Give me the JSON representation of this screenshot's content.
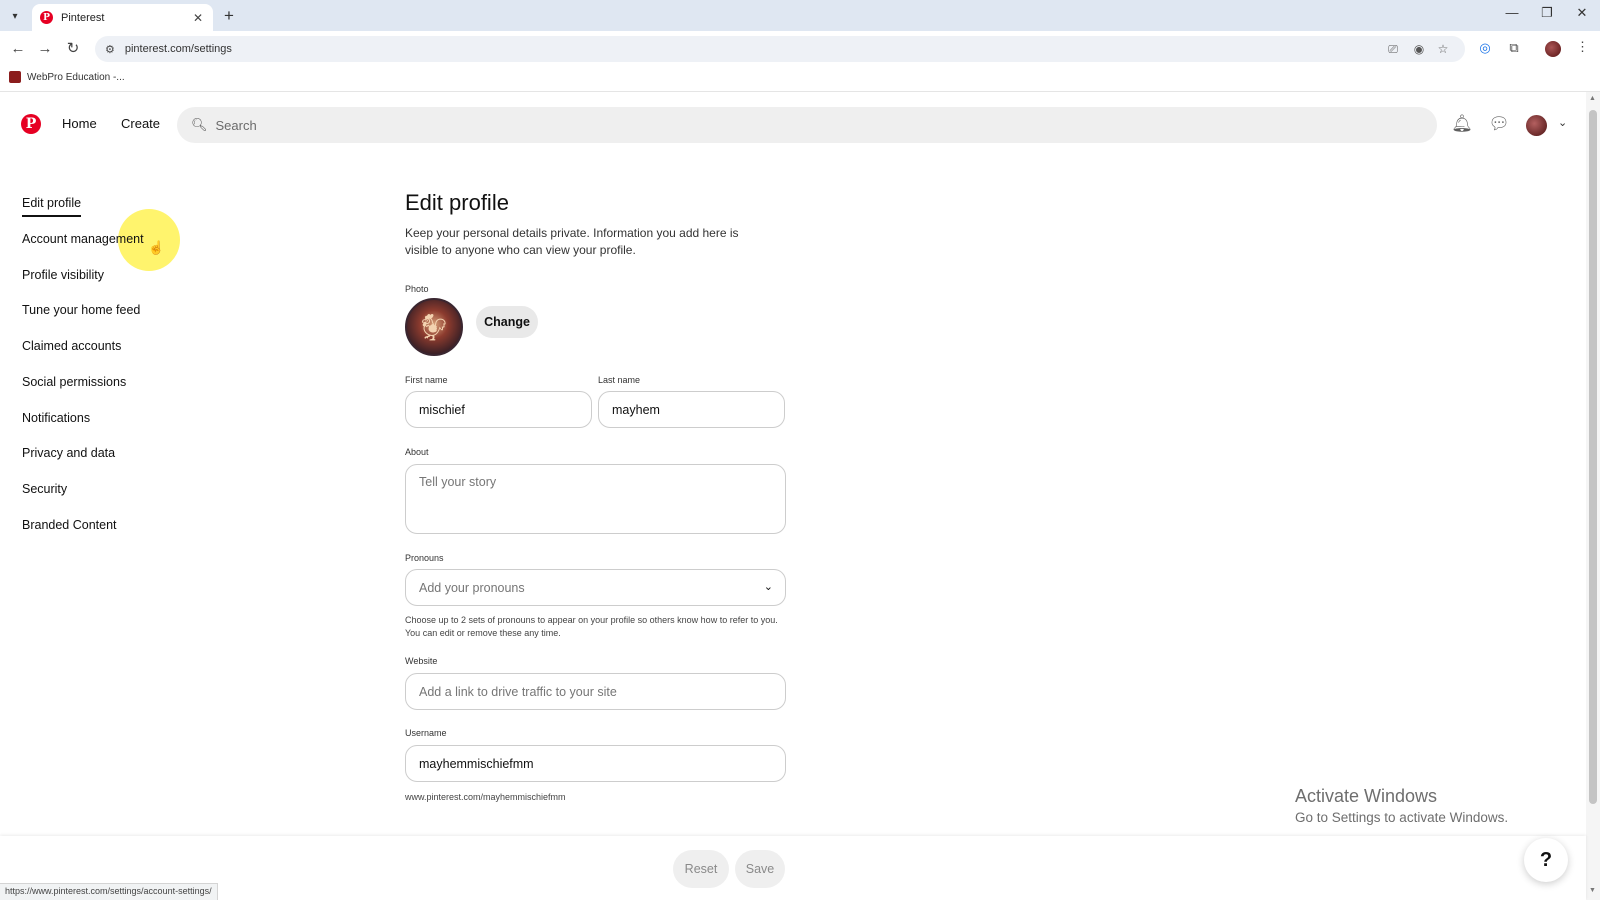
{
  "browser": {
    "tab_title": "Pinterest",
    "url": "pinterest.com/settings",
    "bookmark": "WebPro Education -..."
  },
  "header": {
    "logo": "P",
    "nav_home": "Home",
    "nav_create": "Create",
    "search_placeholder": "Search"
  },
  "sidebar": {
    "items": [
      {
        "label": "Edit profile",
        "active": true
      },
      {
        "label": "Account management"
      },
      {
        "label": "Profile visibility"
      },
      {
        "label": "Tune your home feed"
      },
      {
        "label": "Claimed accounts"
      },
      {
        "label": "Social permissions"
      },
      {
        "label": "Notifications"
      },
      {
        "label": "Privacy and data"
      },
      {
        "label": "Security"
      },
      {
        "label": "Branded Content"
      }
    ]
  },
  "main": {
    "title": "Edit profile",
    "description": "Keep your personal details private. Information you add here is visible to anyone who can view your profile.",
    "photo_label": "Photo",
    "change_button": "Change",
    "first_name_label": "First name",
    "first_name_value": "mischief",
    "last_name_label": "Last name",
    "last_name_value": "mayhem",
    "about_label": "About",
    "about_placeholder": "Tell your story",
    "pronouns_label": "Pronouns",
    "pronouns_placeholder": "Add your pronouns",
    "pronouns_help": "Choose up to 2 sets of pronouns to appear on your profile so others know how to refer to you. You can edit or remove these any time.",
    "website_label": "Website",
    "website_placeholder": "Add a link to drive traffic to your site",
    "username_label": "Username",
    "username_value": "mayhemmischiefmm",
    "profile_url": "www.pinterest.com/mayhemmischiefmm"
  },
  "footer": {
    "reset": "Reset",
    "save": "Save",
    "help": "?"
  },
  "overlay": {
    "activate_title": "Activate Windows",
    "activate_sub": "Go to Settings to activate Windows.",
    "status_url": "https://www.pinterest.com/settings/account-settings/"
  },
  "colors": {
    "brand": "#e60023",
    "tab_strip": "#dfe7f2",
    "cursor_highlight": "#fff03c"
  }
}
